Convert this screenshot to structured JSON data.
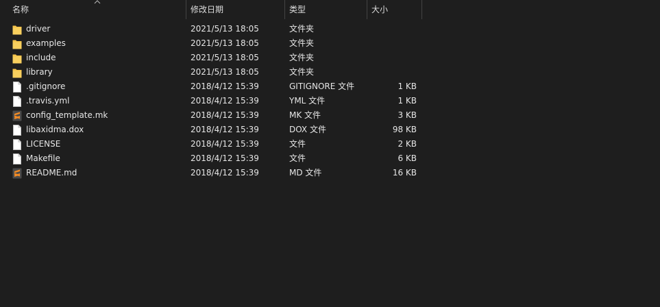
{
  "columns": {
    "name": "名称",
    "date": "修改日期",
    "type": "类型",
    "size": "大小"
  },
  "files": [
    {
      "name": "driver",
      "date": "2021/5/13 18:05",
      "type": "文件夹",
      "size": "",
      "icon": "folder"
    },
    {
      "name": "examples",
      "date": "2021/5/13 18:05",
      "type": "文件夹",
      "size": "",
      "icon": "folder"
    },
    {
      "name": "include",
      "date": "2021/5/13 18:05",
      "type": "文件夹",
      "size": "",
      "icon": "folder"
    },
    {
      "name": "library",
      "date": "2021/5/13 18:05",
      "type": "文件夹",
      "size": "",
      "icon": "folder"
    },
    {
      "name": ".gitignore",
      "date": "2018/4/12 15:39",
      "type": "GITIGNORE 文件",
      "size": "1 KB",
      "icon": "file"
    },
    {
      "name": ".travis.yml",
      "date": "2018/4/12 15:39",
      "type": "YML 文件",
      "size": "1 KB",
      "icon": "file"
    },
    {
      "name": "config_template.mk",
      "date": "2018/4/12 15:39",
      "type": "MK 文件",
      "size": "3 KB",
      "icon": "sublime"
    },
    {
      "name": "libaxidma.dox",
      "date": "2018/4/12 15:39",
      "type": "DOX 文件",
      "size": "98 KB",
      "icon": "file"
    },
    {
      "name": "LICENSE",
      "date": "2018/4/12 15:39",
      "type": "文件",
      "size": "2 KB",
      "icon": "file"
    },
    {
      "name": "Makefile",
      "date": "2018/4/12 15:39",
      "type": "文件",
      "size": "6 KB",
      "icon": "file"
    },
    {
      "name": "README.md",
      "date": "2018/4/12 15:39",
      "type": "MD 文件",
      "size": "16 KB",
      "icon": "sublime"
    }
  ],
  "colors": {
    "background": "#1e1e1e",
    "folder": "#f5c34a",
    "sublime": "#f28b25"
  }
}
